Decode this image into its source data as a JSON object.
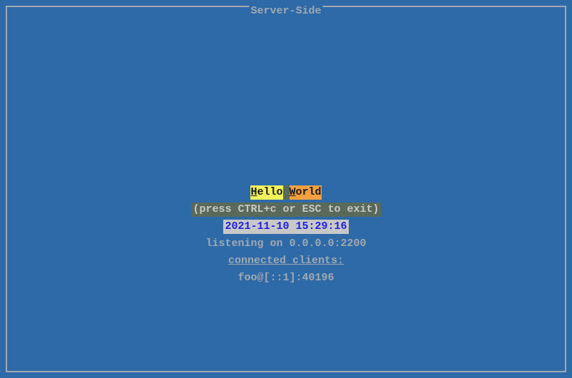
{
  "title": "Server-Side",
  "greeting": {
    "hello_first": "H",
    "hello_rest": "ello",
    "world_first": "W",
    "world_rest": "orld"
  },
  "exit_hint": "(press CTRL+c or ESC to exit)",
  "timestamp": "2021-11-10 15:29:16",
  "listening": "listening on 0.0.0.0:2200",
  "clients_header": "connected clients:",
  "clients": [
    "foo@[::1]:40196"
  ]
}
